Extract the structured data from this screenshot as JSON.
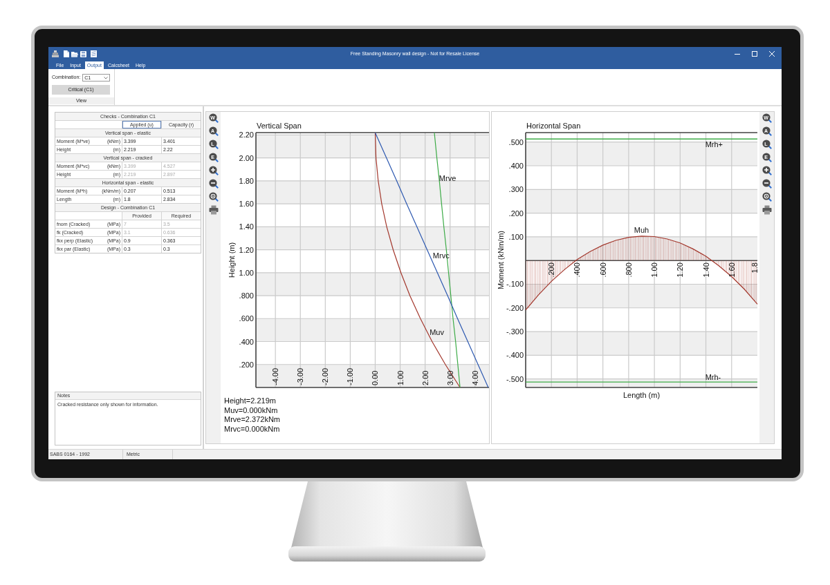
{
  "window": {
    "title": "Free Standing Masonry wall design - Not for Resale License"
  },
  "menu_tabs": [
    {
      "label": "File",
      "selected": false
    },
    {
      "label": "Input",
      "selected": false
    },
    {
      "label": "Output",
      "selected": true
    },
    {
      "label": "Calcsheet",
      "selected": false
    },
    {
      "label": "Help",
      "selected": false
    }
  ],
  "ribbon": {
    "combination_label": "Combination:",
    "combination_value": "C1",
    "button": "Critical (C1)",
    "group_label": "View"
  },
  "checks_table": {
    "rows": [
      {
        "kind": "section",
        "text": "Checks - Combination C1"
      },
      {
        "kind": "header",
        "cells": [
          {
            "text": "Applied (u)",
            "selected": true
          },
          {
            "text": "Capacity (r)",
            "selected": false
          }
        ]
      },
      {
        "kind": "section",
        "text": "Vertical span - elastic"
      },
      {
        "kind": "data",
        "label": "Moment (M*ve)",
        "unit": "(kNm)",
        "values": [
          "3.399",
          "3.401"
        ],
        "disabled": false
      },
      {
        "kind": "data",
        "label": "Height",
        "unit": "(m)",
        "values": [
          "2.219",
          "2.22"
        ],
        "disabled": false
      },
      {
        "kind": "section",
        "text": "Vertical span - cracked"
      },
      {
        "kind": "data",
        "label": "Moment (M*vc)",
        "unit": "(kNm)",
        "values": [
          "3.399",
          "4.527"
        ],
        "disabled": true
      },
      {
        "kind": "data",
        "label": "Height",
        "unit": "(m)",
        "values": [
          "2.219",
          "2.897"
        ],
        "disabled": true
      },
      {
        "kind": "section",
        "text": "Horizontal span - elastic"
      },
      {
        "kind": "data",
        "label": "Moment (M*h)",
        "unit": "(kNm/m)",
        "values": [
          "0.207",
          "0.513"
        ],
        "disabled": false
      },
      {
        "kind": "data",
        "label": "Length",
        "unit": "(m)",
        "values": [
          "1.8",
          "2.834"
        ],
        "disabled": false
      },
      {
        "kind": "section",
        "text": "Design - Combination C1"
      },
      {
        "kind": "header",
        "cells": [
          {
            "text": "Provided",
            "selected": false
          },
          {
            "text": "Required",
            "selected": false
          }
        ]
      },
      {
        "kind": "data",
        "label": "fnom (Cracked)",
        "unit": "(MPa)",
        "values": [
          "7",
          "3.5"
        ],
        "disabled": true
      },
      {
        "kind": "data",
        "label": "fk (Cracked)",
        "unit": "(MPa)",
        "values": [
          "3.1",
          "0.636"
        ],
        "disabled": true
      },
      {
        "kind": "data",
        "label": "fkx perp (Elastic)",
        "unit": "(MPa)",
        "values": [
          "0.9",
          "0.363"
        ],
        "disabled": false
      },
      {
        "kind": "data",
        "label": "fkx par (Elastic)",
        "unit": "(MPa)",
        "values": [
          "0.3",
          "0.3"
        ],
        "disabled": false
      }
    ]
  },
  "notes": {
    "title": "Notes",
    "text": "Cracked resistance only shown for information."
  },
  "vertical_chart": {
    "toolbar": [
      {
        "kind": "lens",
        "text": "W"
      },
      {
        "kind": "lens",
        "text": "A"
      },
      {
        "kind": "lens",
        "text": "L"
      },
      {
        "kind": "lens",
        "text": "E"
      },
      {
        "kind": "zoom-in"
      },
      {
        "kind": "zoom-out"
      },
      {
        "kind": "zoom-fit"
      },
      {
        "kind": "print"
      }
    ],
    "chart_data": {
      "type": "line",
      "orientation": "horizontal",
      "title": "Vertical Span",
      "ylabel": "Height (m)",
      "grid": true,
      "x": [
        0,
        0.2,
        0.4,
        0.6,
        0.8,
        1,
        1.2,
        1.4,
        1.6,
        1.8,
        2,
        2.219
      ],
      "series": [
        {
          "color": "#a3372c",
          "values": [
            3.4,
            2.81,
            2.28,
            1.81,
            1.39,
            1.03,
            0.72,
            0.46,
            0.26,
            0.12,
            0.03,
            0
          ]
        },
        {
          "color": "#3cab46",
          "values": [
            3.4,
            3.31,
            3.22,
            3.12,
            3.03,
            2.94,
            2.85,
            2.75,
            2.66,
            2.57,
            2.47,
            2.37
          ]
        },
        {
          "color": "#2c58b0",
          "values": [
            4.53,
            4.12,
            3.71,
            3.3,
            2.9,
            2.49,
            2.08,
            1.67,
            1.26,
            0.86,
            0.45,
            0
          ]
        }
      ],
      "bands": [
        {
          "axis": "y",
          "from": 0,
          "to": 0.2
        },
        {
          "axis": "y",
          "from": 0.4,
          "to": 0.6
        },
        {
          "axis": "y",
          "from": 0.8,
          "to": 1
        },
        {
          "axis": "y",
          "from": 1.2,
          "to": 1.4
        },
        {
          "axis": "y",
          "from": 1.6,
          "to": 1.8
        },
        {
          "axis": "y",
          "from": 2,
          "to": 2.2
        }
      ],
      "annotations": [
        {
          "text": "Mrve",
          "x": 2.56,
          "y": 1.82
        },
        {
          "text": "Mrvc",
          "x": 2.31,
          "y": 1.15
        },
        {
          "text": "Muv",
          "x": 2.18,
          "y": 0.48
        }
      ],
      "xlim": [
        -4.78,
        4.56
      ],
      "ylim": [
        0,
        2.22
      ],
      "xticks": [
        {
          "value": -4,
          "label": "-4.00"
        },
        {
          "value": -3,
          "label": "-3.00"
        },
        {
          "value": -2,
          "label": "-2.00"
        },
        {
          "value": -1,
          "label": "-1.00"
        },
        {
          "value": 0,
          "label": "0.00"
        },
        {
          "value": 1,
          "label": "1.00"
        },
        {
          "value": 2,
          "label": "2.00"
        },
        {
          "value": 3,
          "label": "3.00"
        },
        {
          "value": 4,
          "label": "4.00"
        }
      ],
      "yticks": [
        {
          "value": 0.2,
          "label": ".200"
        },
        {
          "value": 0.4,
          "label": ".400"
        },
        {
          "value": 0.6,
          "label": ".600"
        },
        {
          "value": 0.8,
          "label": ".800"
        },
        {
          "value": 1,
          "label": "1.00"
        },
        {
          "value": 1.2,
          "label": "1.20"
        },
        {
          "value": 1.4,
          "label": "1.40"
        },
        {
          "value": 1.6,
          "label": "1.60"
        },
        {
          "value": 1.8,
          "label": "1.80"
        },
        {
          "value": 2,
          "label": "2.00"
        },
        {
          "value": 2.2,
          "label": "2.20"
        }
      ]
    },
    "readouts": [
      "Height=2.219m",
      "Muv=0.000kNm",
      "Mrve=2.372kNm",
      "Mrvc=0.000kNm"
    ]
  },
  "horizontal_chart": {
    "chart_data": {
      "type": "area",
      "title": "Horizontal Span",
      "xlabel": "Length (m)",
      "ylabel": "Moment (kNm/m)",
      "grid": true,
      "x": [
        0,
        0.1,
        0.2,
        0.3,
        0.4,
        0.5,
        0.6,
        0.7,
        0.8,
        0.9,
        1,
        1.1,
        1.2,
        1.3,
        1.4,
        1.5,
        1.6,
        1.7,
        1.8
      ],
      "series": [
        {
          "name": "Muh",
          "color": "#a3372c",
          "values": [
            -0.209,
            -0.145,
            -0.088,
            -0.039,
            0.004,
            0.038,
            0.065,
            0.085,
            0.098,
            0.103,
            0.101,
            0.091,
            0.074,
            0.049,
            0.018,
            -0.022,
            -0.068,
            -0.122,
            -0.184
          ]
        }
      ],
      "ref_lines": [
        {
          "axis": "y",
          "value": 0.513,
          "label": "Mrh+",
          "color": "#3cab46"
        },
        {
          "axis": "y",
          "value": -0.513,
          "label": "Mrh-",
          "color": "#3cab46"
        }
      ],
      "bands": [
        {
          "axis": "y",
          "from": 0.4,
          "to": 0.5
        },
        {
          "axis": "y",
          "from": 0.2,
          "to": 0.3
        },
        {
          "axis": "y",
          "from": 0,
          "to": 0.1
        },
        {
          "axis": "y",
          "from": -0.2,
          "to": -0.1
        },
        {
          "axis": "y",
          "from": -0.4,
          "to": -0.3
        },
        {
          "axis": "y",
          "from": -0.536,
          "to": -0.5
        }
      ],
      "xlim": [
        0,
        1.8
      ],
      "ylim": [
        -0.536,
        0.54
      ],
      "xticks": [
        {
          "value": 0.2,
          "label": ".200"
        },
        {
          "value": 0.4,
          "label": ".400"
        },
        {
          "value": 0.6,
          "label": ".600"
        },
        {
          "value": 0.8,
          "label": ".800"
        },
        {
          "value": 1,
          "label": "1.00"
        },
        {
          "value": 1.2,
          "label": "1.20"
        },
        {
          "value": 1.4,
          "label": "1.40"
        },
        {
          "value": 1.6,
          "label": "1.60"
        },
        {
          "value": 1.8,
          "label": "1.8"
        }
      ],
      "yticks": [
        {
          "value": -0.5,
          "label": "-.500"
        },
        {
          "value": -0.4,
          "label": "-.400"
        },
        {
          "value": -0.3,
          "label": "-.300"
        },
        {
          "value": -0.2,
          "label": "-.200"
        },
        {
          "value": -0.1,
          "label": "-.100"
        },
        {
          "value": 0.1,
          "label": ".100"
        },
        {
          "value": 0.2,
          "label": ".200"
        },
        {
          "value": 0.3,
          "label": ".300"
        },
        {
          "value": 0.4,
          "label": ".400"
        },
        {
          "value": 0.5,
          "label": ".500"
        }
      ]
    },
    "toolbar": [
      {
        "kind": "lens",
        "text": "W"
      },
      {
        "kind": "lens",
        "text": "A"
      },
      {
        "kind": "lens",
        "text": "L"
      },
      {
        "kind": "lens",
        "text": "E"
      },
      {
        "kind": "zoom-in"
      },
      {
        "kind": "zoom-out"
      },
      {
        "kind": "zoom-fit"
      },
      {
        "kind": "print"
      }
    ]
  },
  "status_bar": [
    "SABS 0164 - 1992",
    "Metric"
  ]
}
